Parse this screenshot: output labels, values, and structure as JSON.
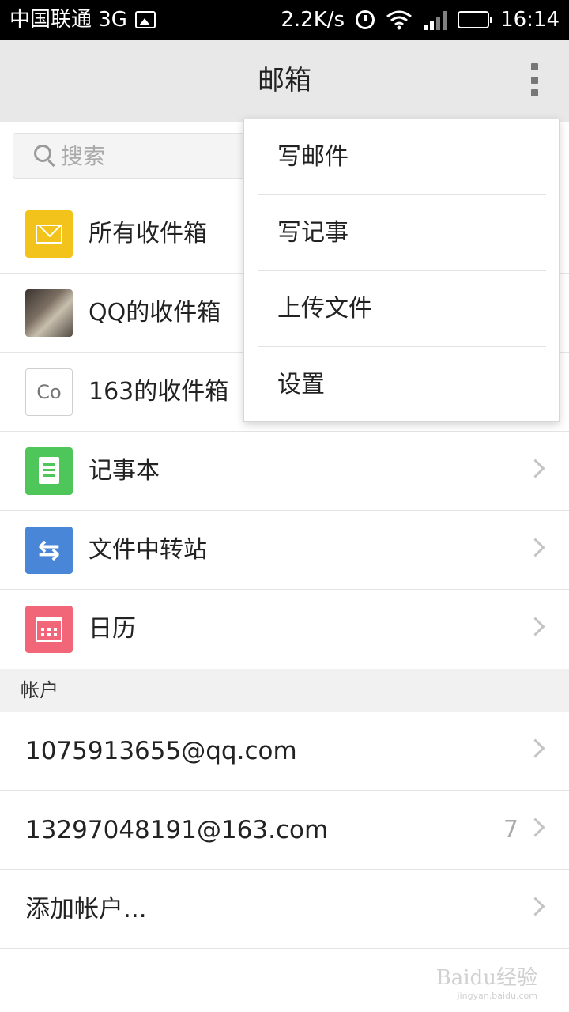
{
  "status_bar": {
    "carrier": "中国联通 3G",
    "speed": "2.2K/s",
    "time": "16:14"
  },
  "header": {
    "title": "邮箱"
  },
  "search": {
    "placeholder": "搜索"
  },
  "folders": [
    {
      "label": "所有收件箱",
      "icon": "mail-icon"
    },
    {
      "label": "QQ的收件箱",
      "icon": "avatar-photo-icon"
    },
    {
      "label": "163的收件箱",
      "icon": "co-icon",
      "icon_text": "Co"
    },
    {
      "label": "记事本",
      "icon": "notepad-icon"
    },
    {
      "label": "文件中转站",
      "icon": "transfer-icon"
    },
    {
      "label": "日历",
      "icon": "calendar-icon"
    }
  ],
  "accounts_section": {
    "title": "帐户",
    "items": [
      {
        "label": "1075913655@qq.com",
        "count": ""
      },
      {
        "label": "13297048191@163.com",
        "count": "7"
      },
      {
        "label": "添加帐户...",
        "count": ""
      }
    ]
  },
  "menu": {
    "items": [
      "写邮件",
      "写记事",
      "上传文件",
      "设置"
    ]
  },
  "watermark": {
    "text": "Baidu经验",
    "sub": "jingyan.baidu.com"
  },
  "colors": {
    "mail": "#f2c41b",
    "note": "#4fc65a",
    "transfer": "#4a86d8",
    "calendar": "#f2667a"
  }
}
